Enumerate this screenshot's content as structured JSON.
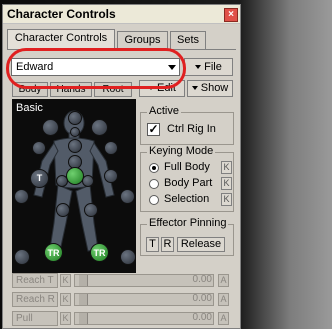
{
  "window": {
    "title": "Character Controls",
    "close": "×"
  },
  "tabs": [
    {
      "label": "Character Controls"
    },
    {
      "label": "Groups"
    },
    {
      "label": "Sets"
    }
  ],
  "character": {
    "selected": "Edward",
    "file_label": "File"
  },
  "subtabs": {
    "body": "Body",
    "hands": "Hands",
    "root": "Root",
    "edit": "Edit",
    "show": "Show"
  },
  "figure": {
    "label": "Basic",
    "node_labels": {
      "t": "T",
      "tr": "TR"
    }
  },
  "active": {
    "title": "Active",
    "ctrl_rig_in": "Ctrl Rig In",
    "checkmark": "✓"
  },
  "keying": {
    "title": "Keying Mode",
    "options": [
      "Full Body",
      "Body Part",
      "Selection"
    ],
    "selected": "Full Body",
    "k": "K"
  },
  "effector": {
    "title": "Effector Pinning",
    "t": "T",
    "r": "R",
    "release": "Release"
  },
  "rows": [
    {
      "name": "Reach T",
      "k": "K",
      "value": "0.00",
      "a": "A"
    },
    {
      "name": "Reach R",
      "k": "K",
      "value": "0.00",
      "a": "A"
    },
    {
      "name": "Pull",
      "k": "K",
      "value": "0.00",
      "a": "A"
    }
  ],
  "colors": {
    "highlight_ring": "#e02020",
    "node_green": "#2e9e32",
    "panel": "#d4d0c8"
  }
}
